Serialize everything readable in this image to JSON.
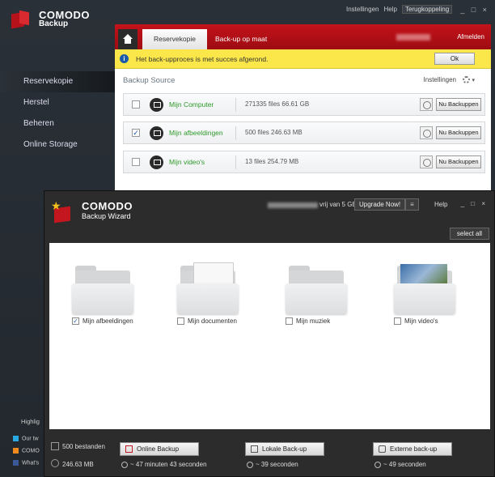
{
  "app": {
    "brand": "COMODO",
    "product": "Backup"
  },
  "top_links": {
    "settings": "Instellingen",
    "help": "Help",
    "feedback": "Terugkoppeling"
  },
  "side_nav": [
    "Reservekopie",
    "Herstel",
    "Beheren",
    "Online Storage"
  ],
  "tabs": {
    "backup": "Reservekopie",
    "custom": "Back-up op maat",
    "logout": "Afmelden"
  },
  "notice": {
    "message": "Het back-upproces is met succes afgerond.",
    "ok": "Ok"
  },
  "backup_source": {
    "title": "Backup Source",
    "settings": "Instellingen",
    "button": "Nu Backuppen"
  },
  "sources": [
    {
      "name": "Mijn Computer",
      "stats": "271335 files 66.61 GB",
      "checked": false
    },
    {
      "name": "Mijn afbeeldingen",
      "stats": "500 files 246.63 MB",
      "checked": true
    },
    {
      "name": "Mijn video's",
      "stats": "13 files 254.79 MB",
      "checked": false
    }
  ],
  "highlights": {
    "title": "Highlig",
    "social": [
      "Our tw",
      "COMO",
      "What's"
    ]
  },
  "wizard": {
    "brand": "COMODO",
    "subtitle": "Backup Wizard",
    "free_space": "vrij van 5 GB",
    "upgrade": "Upgrade Now!",
    "help": "Help",
    "select_all": "select all",
    "folders": [
      {
        "label": "Mijn afbeeldingen",
        "checked": true
      },
      {
        "label": "Mijn documenten",
        "checked": false
      },
      {
        "label": "Mijn muziek",
        "checked": false
      },
      {
        "label": "Mijn video's",
        "checked": false
      }
    ],
    "file_count": "500 bestanden",
    "size": "246.63 MB",
    "actions": [
      {
        "label": "Online Backup",
        "time": "~ 47 minuten 43 seconden"
      },
      {
        "label": "Lokale Back-up",
        "time": "~ 39 seconden"
      },
      {
        "label": "Externe back-up",
        "time": "~ 49 seconden"
      }
    ]
  },
  "colors": {
    "accent_red": "#c4121a",
    "success_green": "#2f9a2a",
    "notice_yellow": "#fbe74a"
  }
}
